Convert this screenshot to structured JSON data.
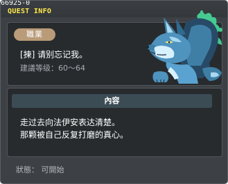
{
  "window": {
    "quest_id": "66925-0",
    "title": "QUEST INFO"
  },
  "header": {
    "job_badge": "職業",
    "quest_name": "[揀] 请别忘记我。",
    "level_label": "建議等级：60～64"
  },
  "content": {
    "section_title": "內容",
    "lines": [
      "走过去向法伊安表达清楚。",
      "那颗被自己反复打磨的真心。"
    ]
  },
  "footer": {
    "status": "狀態： 可開始"
  },
  "colors": {
    "title_yellow": "#ffe94a",
    "window_bg": "#3d4145",
    "panel_bg": "#272b2e",
    "badge_bg": "#b99b79",
    "header_bar": "#3c4c55",
    "wolf_blue": "#3f7fa6",
    "spirit_green": "#49e3a0"
  },
  "icons": {
    "portrait": "blue-wolf-portrait"
  }
}
